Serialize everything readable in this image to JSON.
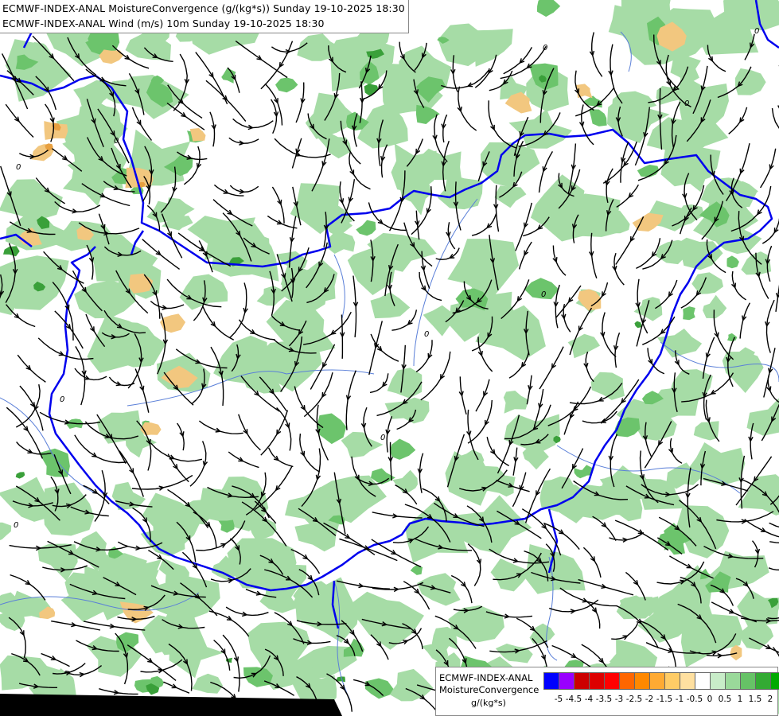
{
  "titles": {
    "line1": "ECMWF-INDEX-ANAL MoistureConvergence (g/(kg*s)) Sunday 19-10-2025 18:30",
    "line2": "ECMWF-INDEX-ANAL Wind (m/s) 10m Sunday 19-10-2025 18:30"
  },
  "legend": {
    "title_line1": "ECMWF-INDEX-ANAL",
    "title_line2": "MoistureConvergence",
    "unit": "g/(kg*s)",
    "colors": [
      "#0000ff",
      "#9900ff",
      "#cc0000",
      "#dd0000",
      "#ff0000",
      "#ff6600",
      "#ff8800",
      "#ffaa33",
      "#ffcc66",
      "#ffe0a0",
      "#ffffff",
      "#c8ecc8",
      "#9ad99a",
      "#66c266",
      "#33aa33",
      "#00aa00"
    ],
    "ticks": [
      "-5",
      "-4.5",
      "-4",
      "-3.5",
      "-3",
      "-2.5",
      "-2",
      "-1.5",
      "-1",
      "-0.5",
      "0",
      "0.5",
      "1",
      "1.5",
      "2"
    ]
  },
  "map": {
    "background_color": "#ffffff",
    "light_green": "#a6dca6",
    "mid_green": "#6cc46c",
    "dark_green": "#3aa03a",
    "orange": "#f2c77f",
    "dark_orange": "#e8a040",
    "border_color": "#0000ee",
    "river_color": "#5a7fd8",
    "streamline_color": "#000000",
    "contour_label": "0"
  }
}
